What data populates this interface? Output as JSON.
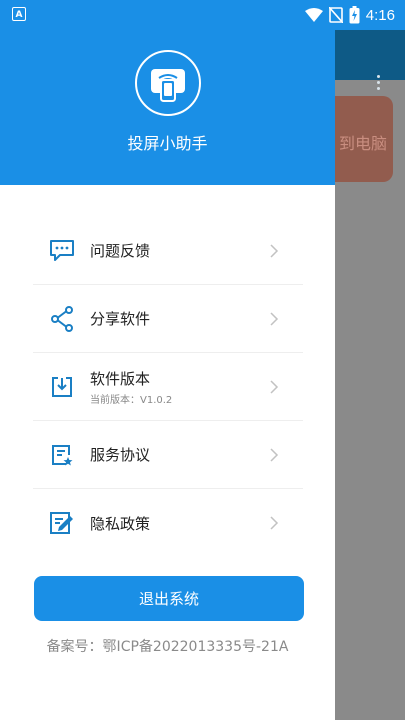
{
  "status_bar": {
    "app_indicator": "A",
    "time": "4:16",
    "icons": [
      "wifi-icon",
      "no-signal-icon",
      "battery-charging-icon"
    ]
  },
  "background": {
    "card_text": "到电脑"
  },
  "drawer": {
    "app_name": "投屏小助手",
    "logo_icon": "cast-phone-icon",
    "menu": [
      {
        "label": "问题反馈",
        "icon": "feedback-icon"
      },
      {
        "label": "分享软件",
        "icon": "share-icon"
      },
      {
        "label": "软件版本",
        "sub": "当前版本：V1.0.2",
        "icon": "download-icon"
      },
      {
        "label": "服务协议",
        "icon": "agreement-icon"
      },
      {
        "label": "隐私政策",
        "icon": "privacy-icon"
      }
    ],
    "logout_label": "退出系统",
    "icp": "备案号：鄂ICP备2022013335号-21A"
  },
  "colors": {
    "primary": "#1a8fe6",
    "icon": "#1a7fc4"
  }
}
